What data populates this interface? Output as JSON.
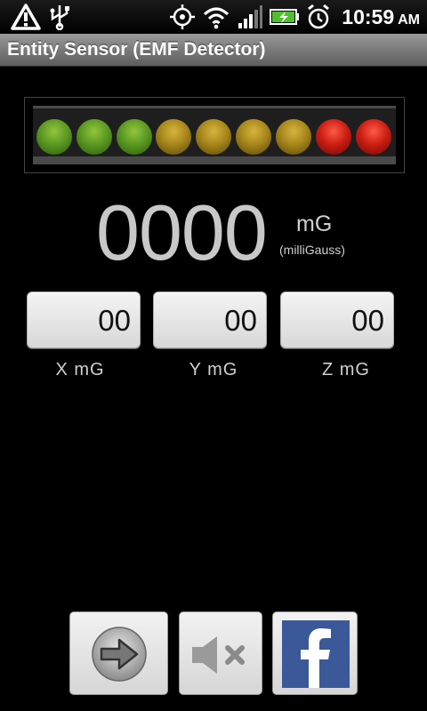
{
  "status_bar": {
    "icons": [
      "warning-icon",
      "usb-icon",
      "gps-icon",
      "wifi-icon",
      "signal-icon",
      "battery-charging-icon",
      "alarm-icon"
    ],
    "time": "10:59",
    "ampm": "AM"
  },
  "app": {
    "title": "Entity Sensor (EMF Detector)"
  },
  "leds": [
    {
      "color": "green"
    },
    {
      "color": "green"
    },
    {
      "color": "green"
    },
    {
      "color": "yellow"
    },
    {
      "color": "yellow"
    },
    {
      "color": "yellow"
    },
    {
      "color": "yellow"
    },
    {
      "color": "red"
    },
    {
      "color": "red"
    }
  ],
  "reading": {
    "value": "0000",
    "unit": "mG",
    "unit_desc": "(milliGauss)"
  },
  "axes": [
    {
      "value": "00",
      "label": "X  mG"
    },
    {
      "value": "00",
      "label": "Y  mG"
    },
    {
      "value": "00",
      "label": "Z  mG"
    }
  ],
  "buttons": [
    {
      "icon": "arrow-right-icon"
    },
    {
      "icon": "mute-icon"
    },
    {
      "icon": "facebook-icon"
    }
  ],
  "colors": {
    "facebook_blue": "#3b5998",
    "reading_gray": "#c8c8c8"
  }
}
